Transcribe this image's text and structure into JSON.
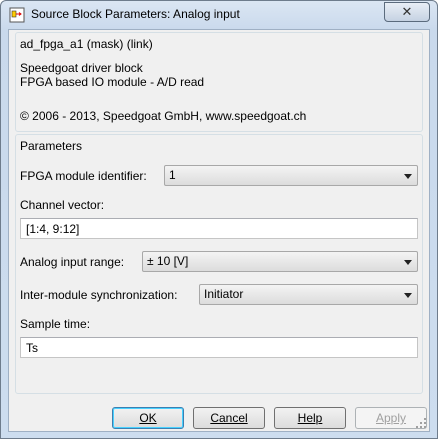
{
  "window": {
    "title": "Source Block Parameters: Analog input",
    "close_glyph": "✕"
  },
  "description": {
    "block_name": "ad_fpga_a1 (mask) (link)",
    "line1": "Speedgoat driver block",
    "line2": "FPGA based IO module - A/D read",
    "copyright": "© 2006 - 2013, Speedgoat GmbH, www.speedgoat.ch"
  },
  "parameters": {
    "header": "Parameters",
    "fpga_label": "FPGA module identifier:",
    "fpga_value": "1",
    "channel_label": "Channel vector:",
    "channel_value": "[1:4, 9:12]",
    "range_label": "Analog input range:",
    "range_value": "± 10 [V]",
    "sync_label": "Inter-module synchronization:",
    "sync_value": "Initiator",
    "sample_label": "Sample time:",
    "sample_value": "Ts"
  },
  "buttons": {
    "ok": "OK",
    "cancel": "Cancel",
    "help": "Help",
    "apply": "Apply"
  },
  "icons": {
    "title_icon": "simulink-block-icon",
    "close_icon": "close-icon",
    "dropdown_icon": "chevron-down-icon",
    "resize_icon": "resize-grip-icon"
  }
}
